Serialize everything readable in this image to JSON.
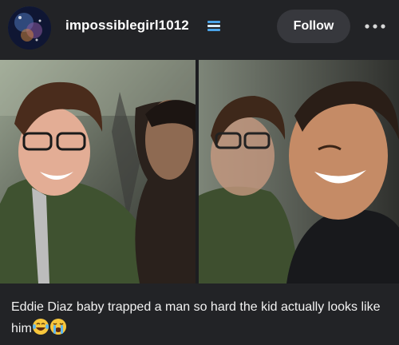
{
  "post": {
    "username": "impossiblegirl1012",
    "follow_label": "Follow",
    "caption": "Eddie Diaz baby trapped a man so hard the kid actually looks like him"
  },
  "icons": {
    "badge": "blue-badge-icon",
    "more": "more-options-icon",
    "emoji_1": "laughing-tears-emoji",
    "emoji_2": "crying-emoji"
  },
  "colors": {
    "background": "#222326",
    "follow_button": "#37383d",
    "badge": "#4aa3e8"
  }
}
